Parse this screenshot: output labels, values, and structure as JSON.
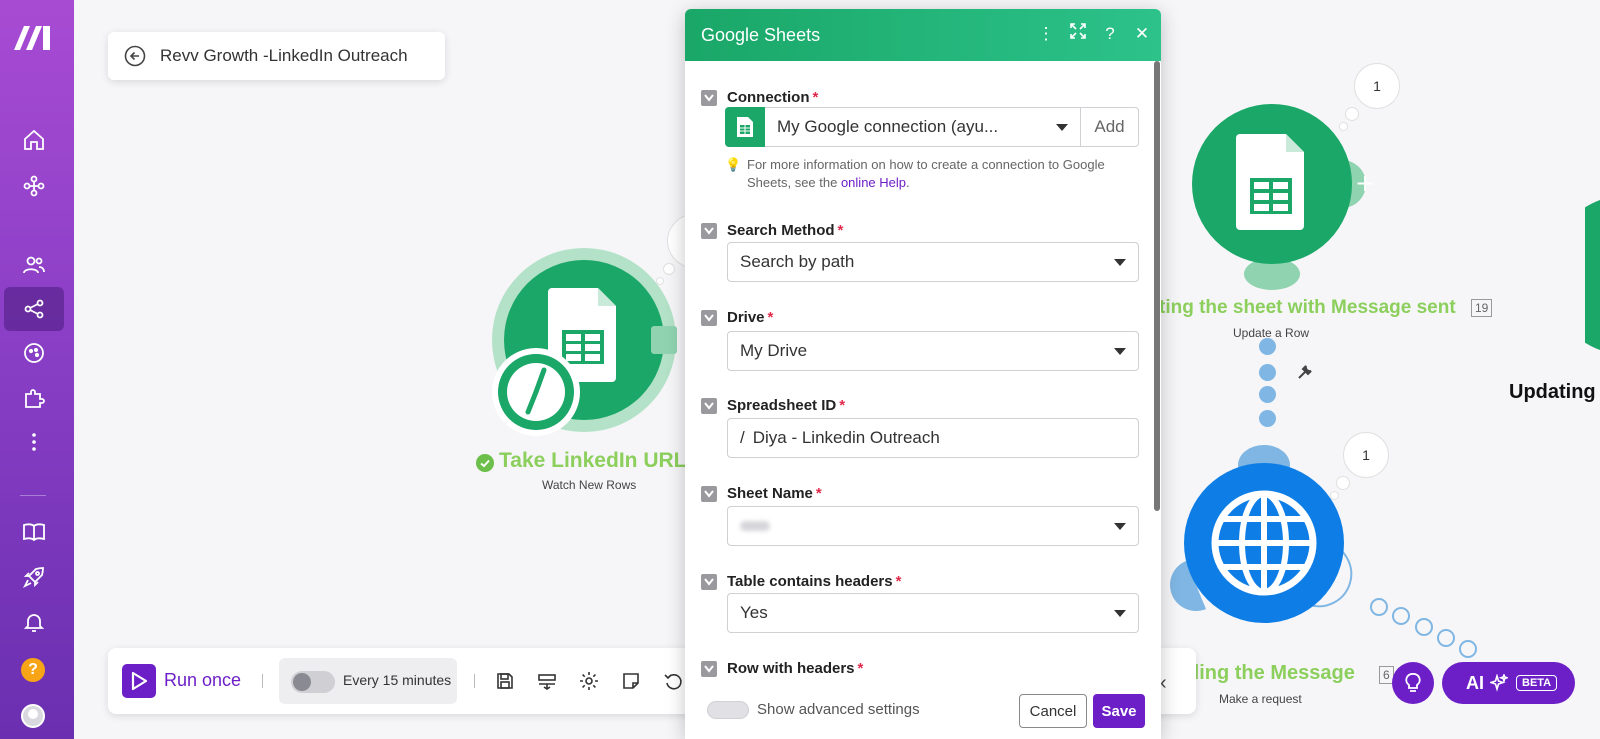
{
  "scenario": {
    "title": "Revv Growth -LinkedIn Outreach"
  },
  "modules": {
    "trigger": {
      "label": "Take LinkedIn URL",
      "subtitle": "Watch New Rows"
    },
    "update_sheet": {
      "label": "ting the sheet with Message sent",
      "subtitle": "Update a Row",
      "number": "19",
      "bubble": "1"
    },
    "http": {
      "label": "ding the Message",
      "subtitle": "Make a request",
      "number": "6",
      "bubble": "1"
    },
    "partial": {
      "label": "Updating t"
    }
  },
  "toolbar": {
    "run_label": "Run once",
    "schedule_label": "Every 15 minutes"
  },
  "ai": {
    "label": "AI",
    "badge": "BETA"
  },
  "modal": {
    "title": "Google Sheets",
    "header_icons": [
      "more-vertical-icon",
      "expand-icon",
      "help-icon",
      "close-icon"
    ],
    "connection": {
      "label": "Connection",
      "value": "My Google connection (ayu...",
      "add_label": "Add",
      "info_text": "For more information on how to create a connection to Google Sheets, see the ",
      "info_link": "online Help",
      "info_end": "."
    },
    "search_method": {
      "label": "Search Method",
      "value": "Search by path"
    },
    "drive": {
      "label": "Drive",
      "value": "My Drive"
    },
    "spreadsheet_id": {
      "label": "Spreadsheet ID",
      "value": "Diya - Linkedin Outreach"
    },
    "sheet_name": {
      "label": "Sheet Name",
      "value": ""
    },
    "table_headers": {
      "label": "Table contains headers",
      "value": "Yes"
    },
    "row_headers": {
      "label": "Row with headers"
    },
    "footer": {
      "advanced_label": "Show advanced settings",
      "cancel_label": "Cancel",
      "save_label": "Save"
    }
  },
  "colors": {
    "accent": "#6d1fc7",
    "sheets_green": "#1aa768",
    "http_blue": "#0e7ee6",
    "label_green": "#8ccf5d"
  }
}
